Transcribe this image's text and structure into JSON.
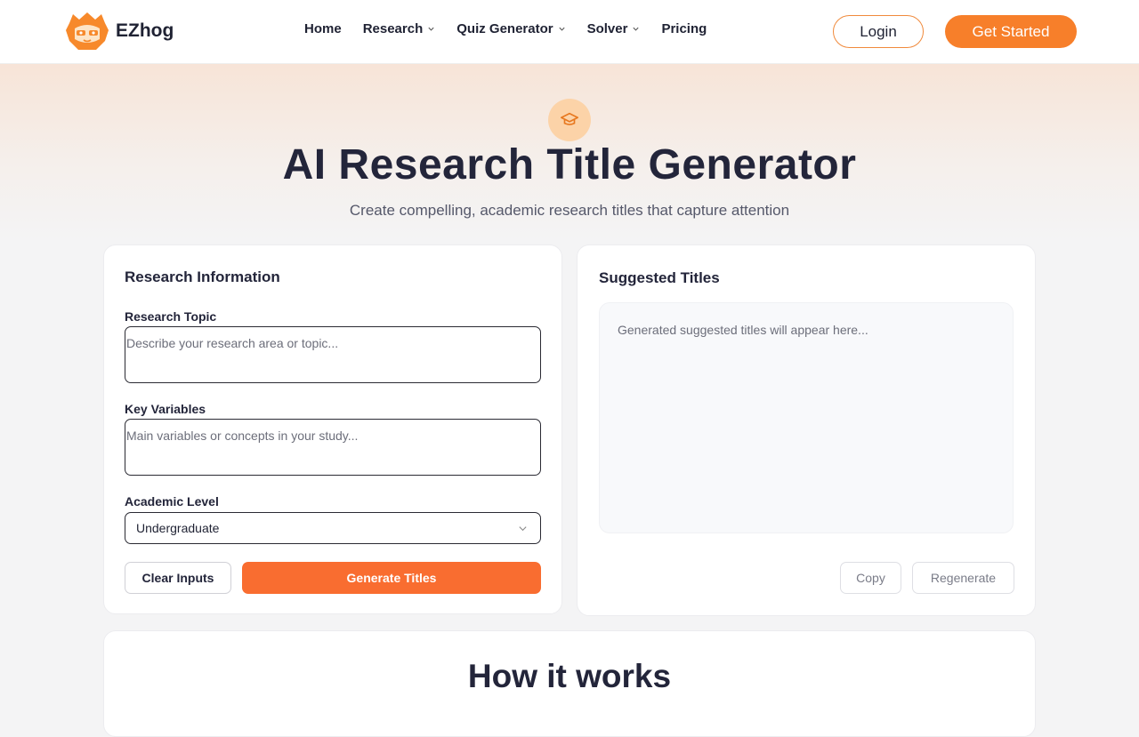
{
  "brand": {
    "name": "EZhog",
    "accent": "#f77f2a"
  },
  "nav": [
    {
      "label": "Home",
      "dropdown": false
    },
    {
      "label": "Research",
      "dropdown": true
    },
    {
      "label": "Quiz Generator",
      "dropdown": true
    },
    {
      "label": "Solver",
      "dropdown": true
    },
    {
      "label": "Pricing",
      "dropdown": false
    }
  ],
  "header": {
    "login_label": "Login",
    "get_started_label": "Get Started"
  },
  "hero": {
    "icon": "graduation-cap-icon",
    "title": "AI Research Title Generator",
    "subtitle": "Create compelling, academic research titles that capture attention"
  },
  "form": {
    "title": "Research Information",
    "topic": {
      "label": "Research Topic",
      "placeholder": "Describe your research area or topic..."
    },
    "variables": {
      "label": "Key Variables",
      "placeholder": "Main variables or concepts in your study..."
    },
    "level": {
      "label": "Academic Level",
      "value": "Undergraduate"
    },
    "clear_label": "Clear Inputs",
    "generate_label": "Generate Titles"
  },
  "output": {
    "title": "Suggested Titles",
    "placeholder": "Generated suggested titles will appear here...",
    "copy_label": "Copy",
    "regenerate_label": "Regenerate"
  },
  "how": {
    "title": "How it works"
  }
}
